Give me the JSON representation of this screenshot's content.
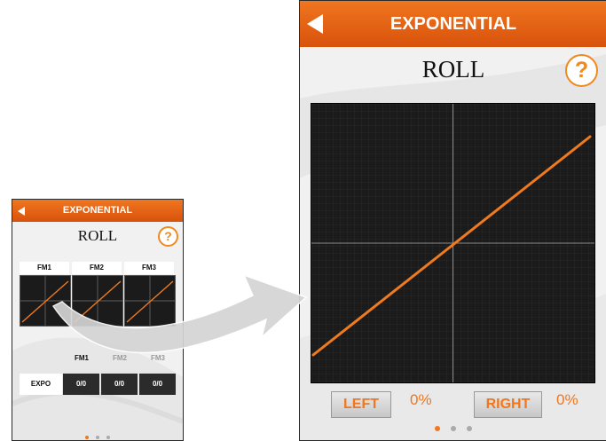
{
  "small_screen": {
    "header_title": "EXPONENTIAL",
    "axis_title": "ROLL",
    "help_glyph": "?",
    "tabs": [
      "FM1",
      "FM2",
      "FM3"
    ],
    "expo_headers": [
      "FM1",
      "FM2",
      "FM3"
    ],
    "expo_label": "EXPO",
    "expo_values": [
      "0/0",
      "0/0",
      "0/0"
    ]
  },
  "big_screen": {
    "header_title": "EXPONENTIAL",
    "axis_title": "ROLL",
    "help_glyph": "?",
    "left_label": "LEFT",
    "left_value": "0%",
    "right_label": "RIGHT",
    "right_value": "0%"
  },
  "pagination": {
    "pages": 3,
    "active_index": 0
  },
  "colors": {
    "accent": "#f0761f",
    "header": "#e0600f",
    "graph_bg": "#1b1b1b",
    "curve": "#f07a1e"
  },
  "icons": {
    "back": "left-triangle-icon",
    "help": "question-circle-icon"
  }
}
